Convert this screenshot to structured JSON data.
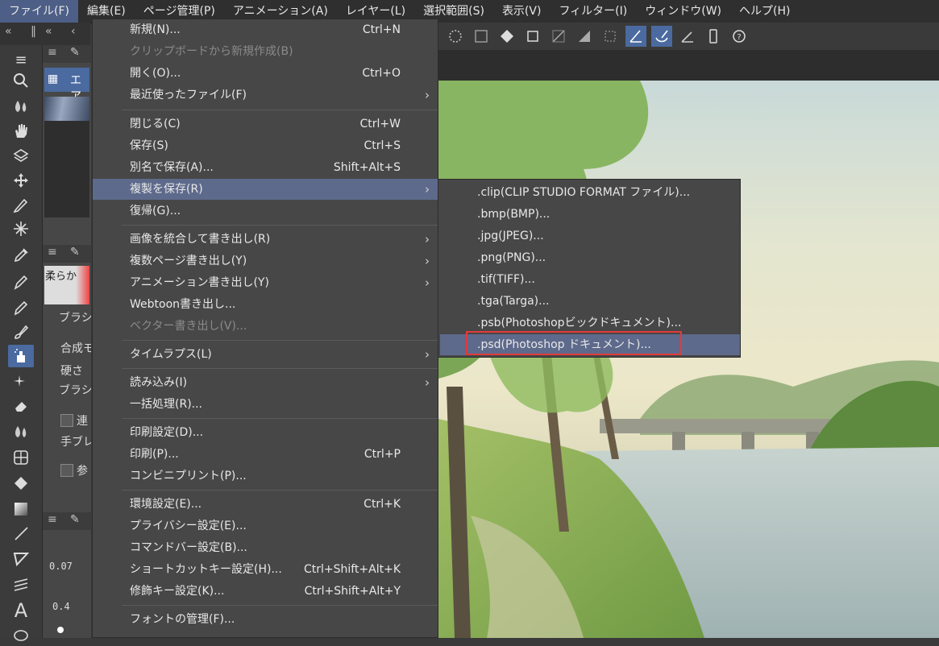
{
  "menubar": [
    "ファイル(F)",
    "編集(E)",
    "ページ管理(P)",
    "アニメーション(A)",
    "レイヤー(L)",
    "選択範囲(S)",
    "表示(V)",
    "フィルター(I)",
    "ウィンドウ(W)",
    "ヘルプ(H)"
  ],
  "file_menu": {
    "items": [
      {
        "label": "新規(N)...",
        "shortcut": "Ctrl+N"
      },
      {
        "label": "クリップボードから新規作成(B)",
        "shortcut": ""
      },
      {
        "label": "開く(O)...",
        "shortcut": "Ctrl+O"
      },
      {
        "label": "最近使ったファイル(F)",
        "shortcut": ""
      },
      {
        "label": "閉じる(C)",
        "shortcut": "Ctrl+W"
      },
      {
        "label": "保存(S)",
        "shortcut": "Ctrl+S"
      },
      {
        "label": "別名で保存(A)...",
        "shortcut": "Shift+Alt+S"
      },
      {
        "label": "複製を保存(R)",
        "shortcut": ""
      },
      {
        "label": "復帰(G)...",
        "shortcut": ""
      },
      {
        "label": "画像を統合して書き出し(R)",
        "shortcut": ""
      },
      {
        "label": "複数ページ書き出し(Y)",
        "shortcut": ""
      },
      {
        "label": "アニメーション書き出し(Y)",
        "shortcut": ""
      },
      {
        "label": "Webtoon書き出し...",
        "shortcut": ""
      },
      {
        "label": "ベクター書き出し(V)...",
        "shortcut": ""
      },
      {
        "label": "タイムラプス(L)",
        "shortcut": ""
      },
      {
        "label": "読み込み(I)",
        "shortcut": ""
      },
      {
        "label": "一括処理(R)...",
        "shortcut": ""
      },
      {
        "label": "印刷設定(D)...",
        "shortcut": ""
      },
      {
        "label": "印刷(P)...",
        "shortcut": "Ctrl+P"
      },
      {
        "label": "コンビニプリント(P)...",
        "shortcut": ""
      },
      {
        "label": "環境設定(E)...",
        "shortcut": "Ctrl+K"
      },
      {
        "label": "プライバシー設定(E)...",
        "shortcut": ""
      },
      {
        "label": "コマンドバー設定(B)...",
        "shortcut": ""
      },
      {
        "label": "ショートカットキー設定(H)...",
        "shortcut": "Ctrl+Shift+Alt+K"
      },
      {
        "label": "修飾キー設定(K)...",
        "shortcut": "Ctrl+Shift+Alt+Y"
      },
      {
        "label": "フォントの管理(F)...",
        "shortcut": ""
      }
    ]
  },
  "save_copy_submenu": {
    "items": [
      ".clip(CLIP STUDIO FORMAT ファイル)...",
      ".bmp(BMP)...",
      ".jpg(JPEG)...",
      ".png(PNG)...",
      ".tif(TIFF)...",
      ".tga(Targa)...",
      ".psb(Photoshopビックドキュメント)...",
      ".psd(Photoshop ドキュメント)..."
    ]
  },
  "sub_tool_panel": {
    "preset_label": "エア",
    "brush_label": "柔らか",
    "rows": [
      "ブラシ",
      "合成モ",
      "硬さ",
      "ブラシ",
      "連",
      "手ブレ",
      "参"
    ],
    "numbers": [
      "0.07",
      "0.4"
    ]
  },
  "icons": [
    "search-icon",
    "hand-icon",
    "move-icon",
    "pen-icon",
    "airbrush-icon",
    "eraser-icon",
    "fill-icon",
    "text-icon"
  ]
}
